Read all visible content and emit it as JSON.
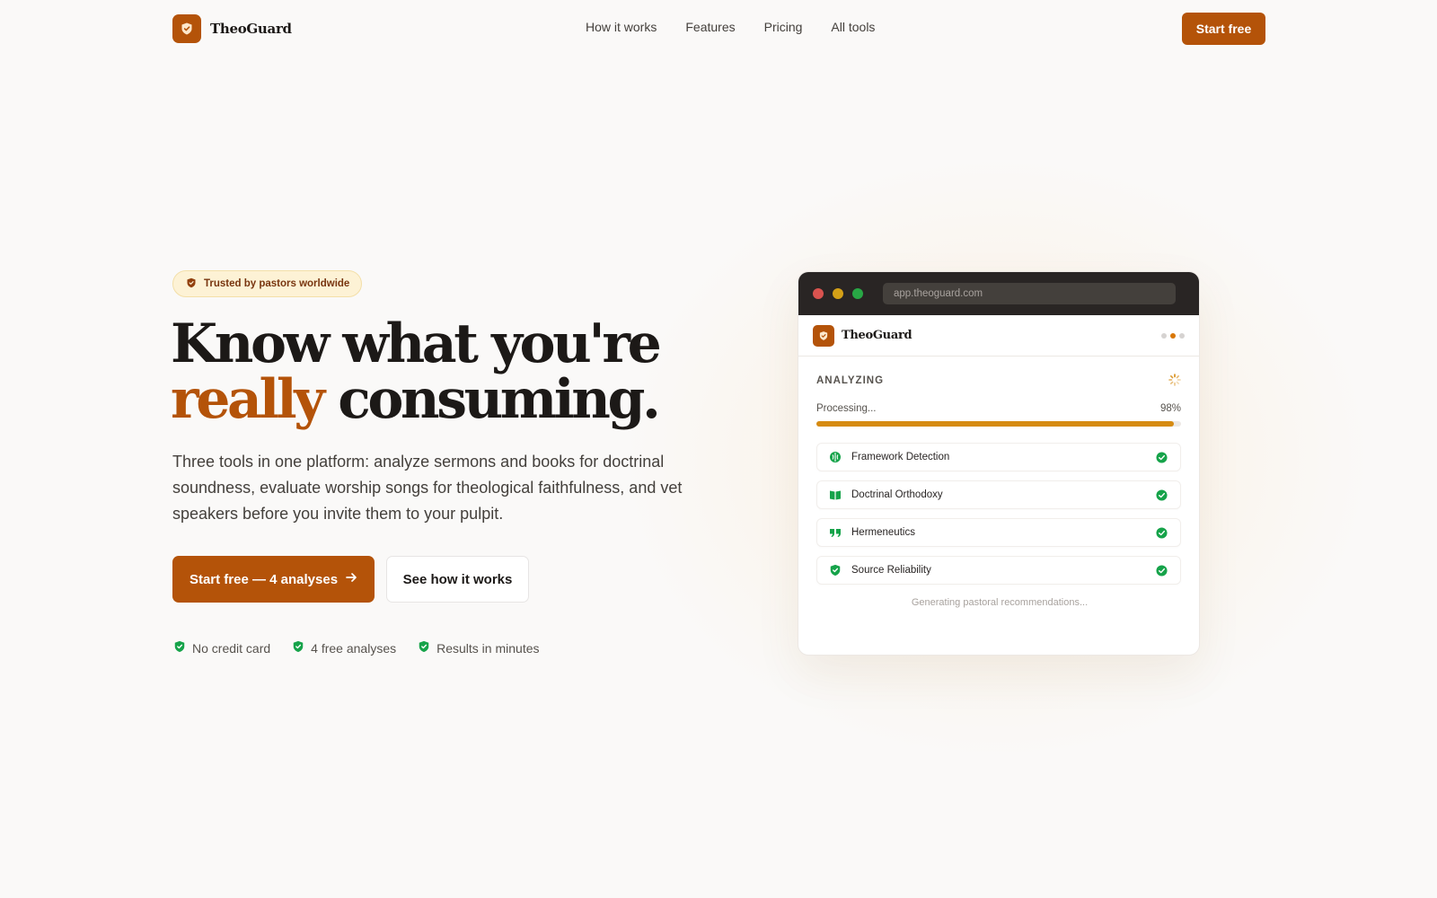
{
  "colors": {
    "brand": "#b45309",
    "success": "#16a34a",
    "progress": "#d68b12",
    "text": "#1c1917"
  },
  "nav": {
    "brand_name": "TheoGuard",
    "links": [
      "How it works",
      "Features",
      "Pricing",
      "All tools"
    ],
    "cta": "Start free"
  },
  "hero": {
    "badge": "Trusted by pastors worldwide",
    "headline_line1": "Know what you're",
    "headline_accent": "really",
    "headline_rest": "consuming.",
    "subtext": "Three tools in one platform: analyze sermons and books for doctrinal soundness, evaluate worship songs for theological faithfulness, and vet speakers before you invite them to your pulpit.",
    "primary_cta": "Start free — 4 analyses",
    "secondary_cta": "See how it works",
    "perks": [
      "No credit card",
      "4 free analyses",
      "Results in minutes"
    ]
  },
  "mockup": {
    "url": "app.theoguard.com",
    "app_name": "TheoGuard",
    "status": "ANALYZING",
    "processing_label": "Processing...",
    "progress_percent": 98,
    "progress_text": "98%",
    "checks": [
      {
        "label": "Framework Detection",
        "icon": "brain-icon"
      },
      {
        "label": "Doctrinal Orthodoxy",
        "icon": "book-icon"
      },
      {
        "label": "Hermeneutics",
        "icon": "quote-icon"
      },
      {
        "label": "Source Reliability",
        "icon": "shield-check-icon"
      }
    ],
    "footer_status": "Generating pastoral recommendations..."
  }
}
